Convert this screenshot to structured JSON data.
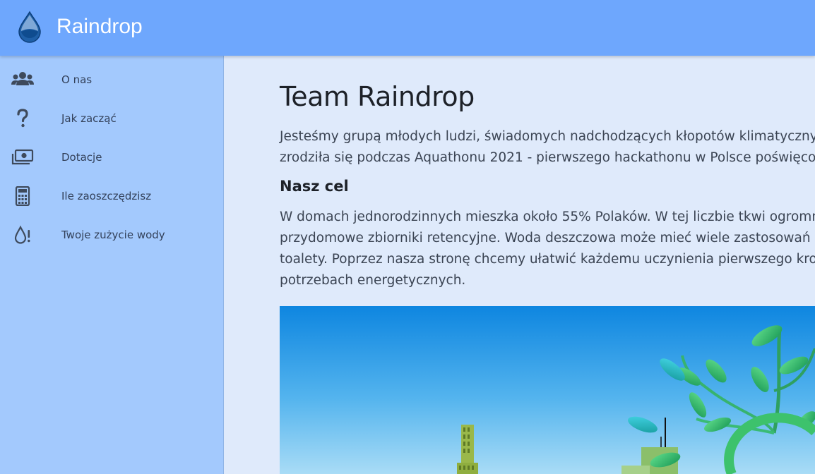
{
  "app": {
    "title": "Raindrop",
    "logo_icon": "water-drop-icon",
    "accent": "#6ea7fd"
  },
  "sidebar": {
    "items": [
      {
        "label": "O nas",
        "icon": "users-icon"
      },
      {
        "label": "Jak zacząć",
        "icon": "question-mark-icon"
      },
      {
        "label": "Dotacje",
        "icon": "money-bill-icon"
      },
      {
        "label": "Ile zaoszczędzisz",
        "icon": "calculator-icon"
      },
      {
        "label": "Twoje zużycie wody",
        "icon": "water-drop-alert-icon"
      }
    ]
  },
  "main": {
    "title": "Team Raindrop",
    "intro_lines": [
      "Jesteśmy grupą młodych ludzi, świadomych nadchodzących kłopotów klimatycznych,",
      "zrodziła się podczas Aquathonu 2021 - pierwszego hackathonu w Polsce poświęcone"
    ],
    "section_title": "Nasz cel",
    "section_lines": [
      "W domach jednorodzinnych mieszka około 55% Polaków. W tej liczbie tkwi ogromny",
      "przydomowe zbiorniki retencyjne. Woda deszczowa może mieć wiele zastosowań - od",
      "toalety. Poprzez nasza stronę chcemy ułatwić każdemu uczynienia pierwszego kroku w",
      "potrzebach energetycznych."
    ],
    "hero_image": "city-and-green-plant-illustration"
  }
}
